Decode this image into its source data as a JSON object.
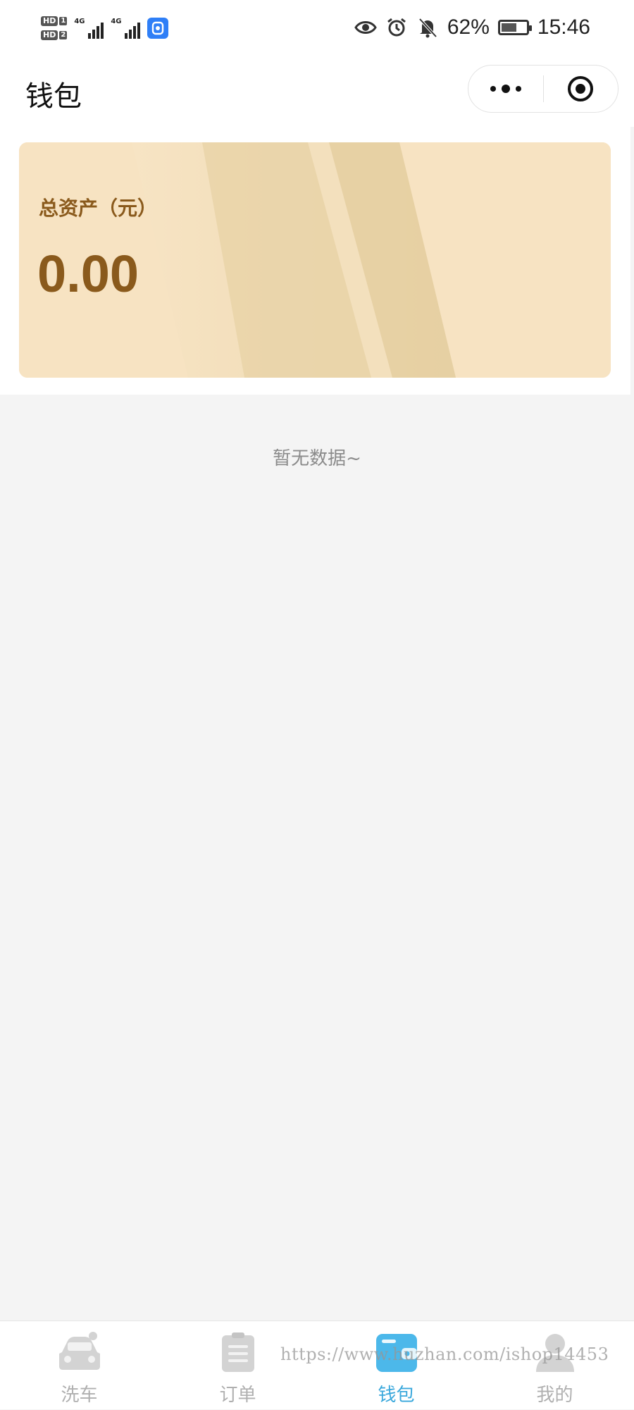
{
  "status_bar": {
    "hd1": "HD",
    "hd1_num": "1",
    "hd2": "HD",
    "hd2_num": "2",
    "network1": "4G",
    "network2": "4G",
    "app_badge_icon": "notification-app-icon",
    "battery_percent": "62%",
    "battery_level": 0.62,
    "time": "15:46",
    "icons": [
      "eye-icon",
      "alarm-icon",
      "bell-off-icon",
      "battery-icon"
    ]
  },
  "nav": {
    "title": "钱包",
    "more_icon": "more-dots-icon",
    "target_icon": "target-icon"
  },
  "wallet": {
    "label": "总资产（元）",
    "amount": "0.00"
  },
  "empty_state": "暂无数据~",
  "tabs": [
    {
      "label": "洗车",
      "icon": "car-icon",
      "active": false
    },
    {
      "label": "订单",
      "icon": "clipboard-icon",
      "active": false
    },
    {
      "label": "钱包",
      "icon": "wallet-icon",
      "active": true
    },
    {
      "label": "我的",
      "icon": "user-icon",
      "active": false
    }
  ],
  "watermark": "https://www.huzhan.com/ishop14453",
  "colors": {
    "card_bg": "#f7e3c1",
    "card_text": "#8a5a1c",
    "tab_active": "#3aa8dc",
    "tab_inactive": "#b0b0b0",
    "page_bg": "#f4f4f4"
  }
}
